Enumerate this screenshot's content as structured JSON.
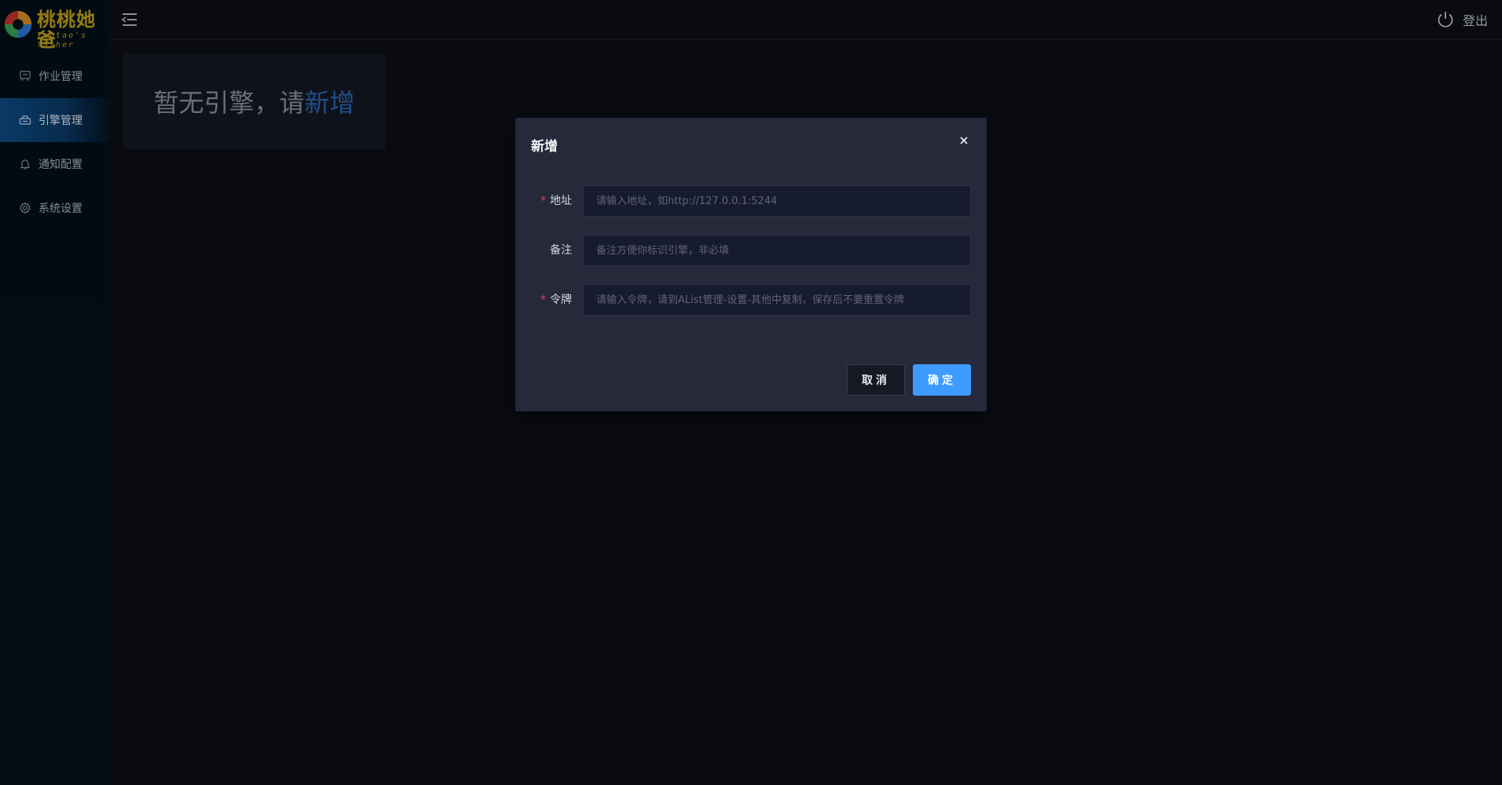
{
  "logo": {
    "title_cn": "桃桃她爸",
    "title_en": "Taotao's father"
  },
  "sidebar": {
    "items": [
      {
        "label": "作业管理",
        "icon": "job-board-icon",
        "active": false
      },
      {
        "label": "引擎管理",
        "icon": "engine-icon",
        "active": true
      },
      {
        "label": "通知配置",
        "icon": "bell-icon",
        "active": false
      },
      {
        "label": "系统设置",
        "icon": "gear-icon",
        "active": false
      }
    ]
  },
  "header": {
    "logout_label": "登出"
  },
  "main": {
    "empty_text": "暂无引擎，请",
    "empty_link": "新增"
  },
  "modal": {
    "title": "新增",
    "fields": [
      {
        "label": "地址",
        "required": true,
        "value": "",
        "placeholder": "请输入地址，如http://127.0.0.1:5244"
      },
      {
        "label": "备注",
        "required": false,
        "value": "",
        "placeholder": "备注方便你标识引擎，非必填"
      },
      {
        "label": "令牌",
        "required": true,
        "value": "",
        "placeholder": "请输入令牌，请到AList管理-设置-其他中复制，保存后不要重置令牌"
      }
    ],
    "required_mark": "*",
    "cancel_label": "取消",
    "ok_label": "确定"
  },
  "colors": {
    "accent": "#3f9bff",
    "link": "#2e6ab5",
    "required": "#e0464a",
    "logo": "#c9a41a"
  }
}
